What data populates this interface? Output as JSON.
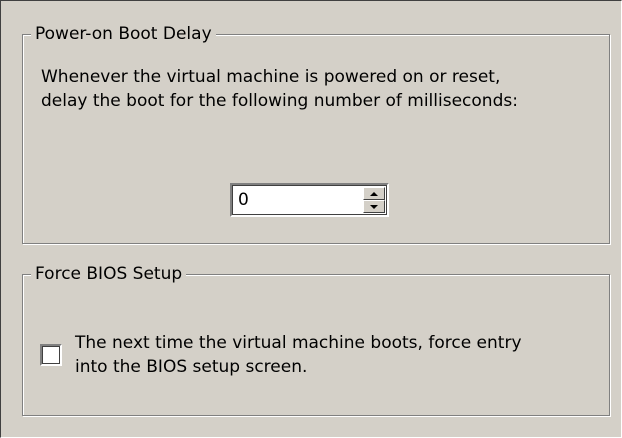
{
  "boot_delay": {
    "title": "Power-on Boot Delay",
    "description": "Whenever the virtual machine is powered on or reset,\ndelay the boot for the following number of milliseconds:",
    "delay_value": "0",
    "spinner_up_icon": "arrow-up-icon",
    "spinner_down_icon": "arrow-down-icon"
  },
  "bios_setup": {
    "title": "Force BIOS Setup",
    "checkbox_label": "The next time the virtual machine boots, force entry\ninto the BIOS setup screen.",
    "checked": false
  }
}
